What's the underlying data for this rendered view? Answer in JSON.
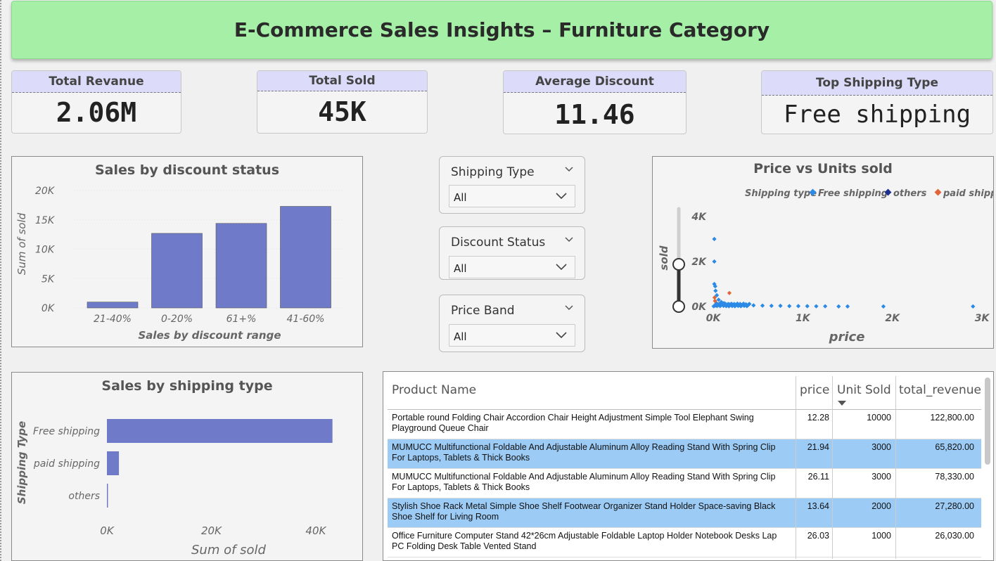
{
  "header": {
    "title": "E-Commerce Sales Insights – Furniture Category"
  },
  "kpis": [
    {
      "label": "Total Revanue",
      "value": "2.06M"
    },
    {
      "label": "Total Sold",
      "value": "45K"
    },
    {
      "label": "Average Discount",
      "value": "11.46"
    },
    {
      "label": "Top Shipping Type",
      "value": "Free shipping"
    }
  ],
  "slicers": [
    {
      "label": "Shipping Type",
      "selected": "All"
    },
    {
      "label": "Discount Status",
      "selected": "All"
    },
    {
      "label": "Price Band",
      "selected": "All"
    }
  ],
  "chart_data": [
    {
      "type": "bar",
      "title": "Sales by discount status",
      "xlabel": "Sales by discount range",
      "ylabel": "Sum of sold",
      "categories": [
        "21-40%",
        "0-20%",
        "61+%",
        "41-60%"
      ],
      "values": [
        1000,
        12700,
        14400,
        17300
      ],
      "yticks": [
        "0K",
        "5K",
        "10K",
        "15K",
        "20K"
      ],
      "ylim": [
        0,
        20000
      ],
      "color": "#6f7bc9"
    },
    {
      "type": "scatter",
      "title": "Price vs Units sold",
      "xlabel": "price",
      "ylabel": "sold",
      "legend_title": "Shipping type",
      "legend": [
        {
          "name": "Free shipping",
          "color": "#2b8ae6"
        },
        {
          "name": "others",
          "color": "#1a2f8f"
        },
        {
          "name": "paid shipping",
          "color": "#e0663a"
        }
      ],
      "xticks": [
        "0K",
        "1K",
        "2K",
        "3K"
      ],
      "yticks": [
        "0K",
        "2K",
        "4K"
      ],
      "xlim": [
        0,
        3000
      ],
      "ylim": [
        0,
        4000
      ],
      "points": [
        {
          "x": 12,
          "y": 3000,
          "s": 0
        },
        {
          "x": 12,
          "y": 2000,
          "s": 0
        },
        {
          "x": 12,
          "y": 1000,
          "s": 0
        },
        {
          "x": 22,
          "y": 900,
          "s": 0
        },
        {
          "x": 26,
          "y": 700,
          "s": 0
        },
        {
          "x": 40,
          "y": 500,
          "s": 0
        },
        {
          "x": 60,
          "y": 300,
          "s": 0
        },
        {
          "x": 90,
          "y": 200,
          "s": 0
        },
        {
          "x": 120,
          "y": 150,
          "s": 0
        },
        {
          "x": 180,
          "y": 100,
          "s": 0
        },
        {
          "x": 250,
          "y": 80,
          "s": 0
        },
        {
          "x": 350,
          "y": 60,
          "s": 0
        },
        {
          "x": 450,
          "y": 50,
          "s": 0
        },
        {
          "x": 550,
          "y": 40,
          "s": 0
        },
        {
          "x": 650,
          "y": 30,
          "s": 0
        },
        {
          "x": 750,
          "y": 30,
          "s": 0
        },
        {
          "x": 850,
          "y": 20,
          "s": 0
        },
        {
          "x": 950,
          "y": 20,
          "s": 0
        },
        {
          "x": 1050,
          "y": 15,
          "s": 0
        },
        {
          "x": 1150,
          "y": 10,
          "s": 0
        },
        {
          "x": 1250,
          "y": 10,
          "s": 0
        },
        {
          "x": 1400,
          "y": 5,
          "s": 0
        },
        {
          "x": 1500,
          "y": 5,
          "s": 0
        },
        {
          "x": 1900,
          "y": 5,
          "s": 0
        },
        {
          "x": 2900,
          "y": 5,
          "s": 0
        },
        {
          "x": 15,
          "y": 400,
          "s": 2
        },
        {
          "x": 20,
          "y": 250,
          "s": 2
        },
        {
          "x": 35,
          "y": 150,
          "s": 2
        },
        {
          "x": 60,
          "y": 100,
          "s": 2
        },
        {
          "x": 120,
          "y": 50,
          "s": 2
        },
        {
          "x": 180,
          "y": 600,
          "s": 2
        },
        {
          "x": 25,
          "y": 50,
          "s": 1
        }
      ]
    },
    {
      "type": "bar",
      "orientation": "horizontal",
      "title": "Sales by shipping type",
      "xlabel": "Sum of sold",
      "ylabel": "Shipping Type",
      "categories": [
        "Free shipping",
        "paid shipping",
        "others"
      ],
      "values": [
        43200,
        2300,
        200
      ],
      "xticks": [
        "0K",
        "20K",
        "40K"
      ],
      "xlim": [
        0,
        45000
      ],
      "color": "#6f7bc9"
    }
  ],
  "table": {
    "columns": [
      "Product Name",
      "price",
      "Unit Sold",
      "total_revenue"
    ],
    "rows": [
      {
        "name": "Portable round Folding Chair Accordion Chair Height Adjustment Simple Tool Elephant Swing Playground Queue Chair",
        "price": "12.28",
        "sold": "10000",
        "revenue": "122,800.00",
        "highlight": false
      },
      {
        "name": "MUMUCC Multifunctional Foldable And Adjustable Aluminum Alloy Reading Stand With Spring Clip For Laptops, Tablets & Thick Books",
        "price": "21.94",
        "sold": "3000",
        "revenue": "65,820.00",
        "highlight": true
      },
      {
        "name": "MUMUCC Multifunctional Foldable And Adjustable Aluminum Alloy Reading Stand With Spring Clip For Laptops, Tablets & Thick Books",
        "price": "26.11",
        "sold": "3000",
        "revenue": "78,330.00",
        "highlight": false
      },
      {
        "name": "Stylish Shoe Rack Metal Simple Shoe Shelf Footwear Organizer Stand Holder Space-saving Black Shoe Shelf for Living Room",
        "price": "13.64",
        "sold": "2000",
        "revenue": "27,280.00",
        "highlight": true
      },
      {
        "name": "Office Furniture Computer Stand 42*26cm Adjustable Foldable Laptop Holder Notebook Desks Lap PC Folding Desk Table Vented Stand",
        "price": "26.03",
        "sold": "1000",
        "revenue": "26,030.00",
        "highlight": false
      }
    ]
  }
}
